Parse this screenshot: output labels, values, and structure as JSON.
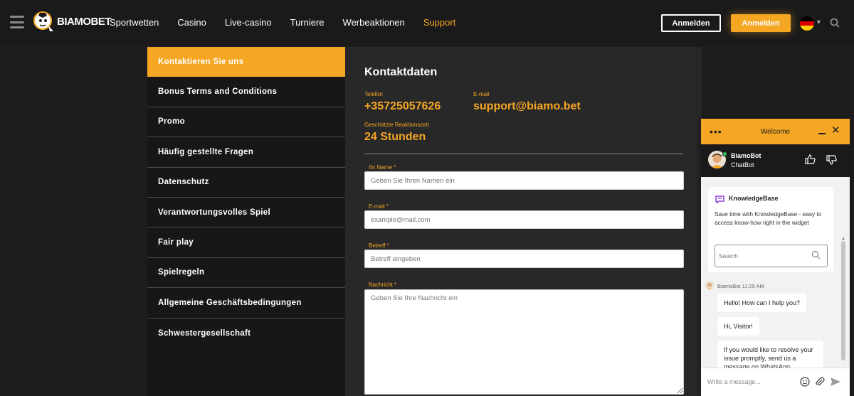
{
  "brand": {
    "name_a": "BIAMO",
    "name_b": "BET",
    "accent": "#f5a623"
  },
  "nav": {
    "items": [
      {
        "label": "Sportwetten"
      },
      {
        "label": "Casino"
      },
      {
        "label": "Live-casino"
      },
      {
        "label": "Turniere"
      },
      {
        "label": "Werbeaktionen"
      },
      {
        "label": "Support"
      }
    ],
    "active": "Support"
  },
  "header": {
    "login_label": "Anmelden",
    "register_label": "Anmelden",
    "language_flag": "germany-flag-icon"
  },
  "sidebar": {
    "items": [
      {
        "label": "Kontaktieren Sie uns"
      },
      {
        "label": "Bonus Terms and Conditions"
      },
      {
        "label": "Promo"
      },
      {
        "label": "Häufig gestellte Fragen"
      },
      {
        "label": "Datenschutz"
      },
      {
        "label": "Verantwortungsvolles Spiel"
      },
      {
        "label": "Fair play"
      },
      {
        "label": "Spielregeln"
      },
      {
        "label": "Allgemeine Geschäftsbedingungen"
      },
      {
        "label": "Schwestergesellschaft"
      }
    ]
  },
  "contact": {
    "title": "Kontaktdaten",
    "phone_label": "Telefon",
    "phone": "+35725057626",
    "email_label": "E-mail",
    "email": "support@biamo.bet",
    "response_label": "Geschätzte Reaktionszeit",
    "response": "24 Stunden"
  },
  "form": {
    "name_label": "Ihr Name *",
    "name_placeholder": "Geben Sie Ihren Namen ein",
    "email_label": "E-mail *",
    "email_placeholder": "example@mail.com",
    "subject_label": "Betreff *",
    "subject_placeholder": "Betreff eingeben",
    "message_label": "Nachricht *",
    "message_placeholder": "Geben Sie Ihre Nachricht ein"
  },
  "chat": {
    "header_title": "Welcome",
    "bot_name": "BiamoBot",
    "bot_sub": "ChatBot",
    "kb_title": "KnowledgeBase",
    "kb_desc": "Save time with KnowledgeBase - easy to access know-how right in the widget",
    "kb_search_placeholder": "Search",
    "msg_sender": "BiamoBot",
    "msg_time": "11:29 AM",
    "messages": [
      "Hello! How can I help you?",
      "Hi, Visitor!",
      "If you would like to resolve your issue promptly, send us a message on WhatsApp"
    ],
    "input_placeholder": "Write a message..."
  }
}
